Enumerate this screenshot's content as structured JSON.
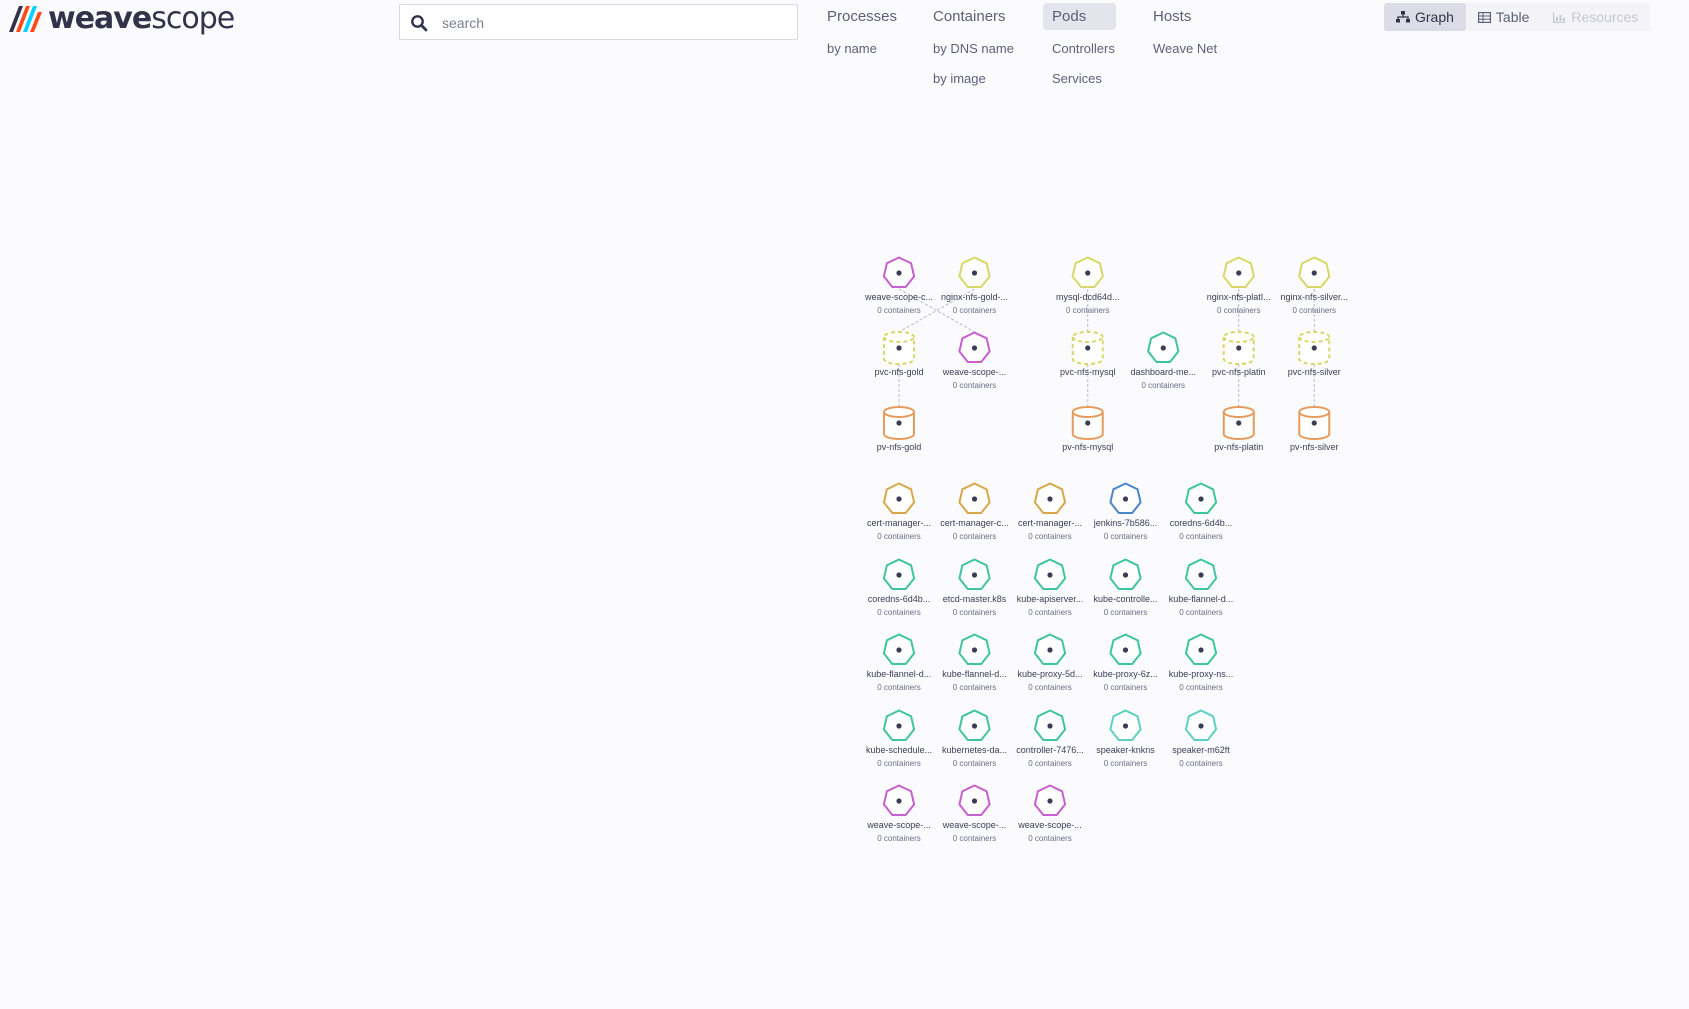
{
  "app": {
    "logo_weave": "weave",
    "logo_scope": "scope",
    "brand_colors": [
      "#ff4b19",
      "#00d2ff",
      "#32324b"
    ]
  },
  "search": {
    "placeholder": "search",
    "value": "",
    "icon": "search-icon"
  },
  "topologies": [
    {
      "label": "Processes",
      "active": false,
      "subs": [
        "by name"
      ]
    },
    {
      "label": "Containers",
      "active": false,
      "subs": [
        "by DNS name",
        "by image"
      ]
    },
    {
      "label": "Pods",
      "active": true,
      "subs": [
        "Controllers",
        "Services"
      ]
    },
    {
      "label": "Hosts",
      "active": false,
      "subs": [
        "Weave Net"
      ]
    }
  ],
  "view_modes": [
    {
      "label": "Graph",
      "icon": "graph-icon",
      "active": true,
      "disabled": false
    },
    {
      "label": "Table",
      "icon": "table-icon",
      "active": false,
      "disabled": false
    },
    {
      "label": "Resources",
      "icon": "resources-icon",
      "active": false,
      "disabled": true
    }
  ],
  "node_sublabel": "0 containers",
  "colors": {
    "magenta": "#c75fce",
    "yellow": "#d7d76a",
    "orange": "#e69b5e",
    "gold": "#d8a74a",
    "teal": "#3fc59b",
    "blue": "#4c86c6",
    "cyan": "#5dd0c2"
  },
  "nodes": [
    {
      "id": "n1",
      "label": "weave-scope-c...",
      "sub": true,
      "shape": "heptagon",
      "color": "magenta",
      "col": 0,
      "row": 0
    },
    {
      "id": "n2",
      "label": "nginx-nfs-gold-...",
      "sub": true,
      "shape": "heptagon",
      "color": "yellow",
      "col": 1,
      "row": 0
    },
    {
      "id": "n3",
      "label": "mysql-dcd64d...",
      "sub": true,
      "shape": "heptagon",
      "color": "yellow",
      "col": 2.5,
      "row": 0
    },
    {
      "id": "n4",
      "label": "nginx-nfs-platI...",
      "sub": true,
      "shape": "heptagon",
      "color": "yellow",
      "col": 4.5,
      "row": 0
    },
    {
      "id": "n5",
      "label": "nginx-nfs-silver...",
      "sub": true,
      "shape": "heptagon",
      "color": "yellow",
      "col": 5.5,
      "row": 0
    },
    {
      "id": "n6",
      "label": "pvc-nfs-gold",
      "sub": false,
      "shape": "cylinder-dashed",
      "color": "yellow",
      "col": 0,
      "row": 1
    },
    {
      "id": "n7",
      "label": "weave-scope-...",
      "sub": true,
      "shape": "heptagon",
      "color": "magenta",
      "col": 1,
      "row": 1
    },
    {
      "id": "n8",
      "label": "pvc-nfs-mysql",
      "sub": false,
      "shape": "cylinder-dashed",
      "color": "yellow",
      "col": 2.5,
      "row": 1
    },
    {
      "id": "n9",
      "label": "dashboard-me...",
      "sub": true,
      "shape": "heptagon",
      "color": "teal",
      "col": 3.5,
      "row": 1
    },
    {
      "id": "n10",
      "label": "pvc-nfs-platin",
      "sub": false,
      "shape": "cylinder-dashed",
      "color": "yellow",
      "col": 4.5,
      "row": 1
    },
    {
      "id": "n11",
      "label": "pvc-nfs-silver",
      "sub": false,
      "shape": "cylinder-dashed",
      "color": "yellow",
      "col": 5.5,
      "row": 1
    },
    {
      "id": "n12",
      "label": "pv-nfs-gold",
      "sub": false,
      "shape": "cylinder",
      "color": "orange",
      "col": 0,
      "row": 2
    },
    {
      "id": "n13",
      "label": "pv-nfs-mysql",
      "sub": false,
      "shape": "cylinder",
      "color": "orange",
      "col": 2.5,
      "row": 2
    },
    {
      "id": "n14",
      "label": "pv-nfs-platin",
      "sub": false,
      "shape": "cylinder",
      "color": "orange",
      "col": 4.5,
      "row": 2
    },
    {
      "id": "n15",
      "label": "pv-nfs-silver",
      "sub": false,
      "shape": "cylinder",
      "color": "orange",
      "col": 5.5,
      "row": 2
    },
    {
      "id": "g1",
      "label": "cert-manager-...",
      "sub": true,
      "shape": "heptagon",
      "color": "gold",
      "col": 0,
      "row": 3
    },
    {
      "id": "g2",
      "label": "cert-manager-c...",
      "sub": true,
      "shape": "heptagon",
      "color": "gold",
      "col": 1,
      "row": 3
    },
    {
      "id": "g3",
      "label": "cert-manager-...",
      "sub": true,
      "shape": "heptagon",
      "color": "gold",
      "col": 2,
      "row": 3
    },
    {
      "id": "g4",
      "label": "jenkins-7b586...",
      "sub": true,
      "shape": "heptagon",
      "color": "blue",
      "col": 3,
      "row": 3
    },
    {
      "id": "g5",
      "label": "coredns-6d4b...",
      "sub": true,
      "shape": "heptagon",
      "color": "teal",
      "col": 4,
      "row": 3
    },
    {
      "id": "g6",
      "label": "coredns-6d4b...",
      "sub": true,
      "shape": "heptagon",
      "color": "teal",
      "col": 0,
      "row": 4
    },
    {
      "id": "g7",
      "label": "etcd-master.k8s",
      "sub": true,
      "shape": "heptagon",
      "color": "teal",
      "col": 1,
      "row": 4
    },
    {
      "id": "g8",
      "label": "kube-apiserver...",
      "sub": true,
      "shape": "heptagon",
      "color": "teal",
      "col": 2,
      "row": 4
    },
    {
      "id": "g9",
      "label": "kube-controlle...",
      "sub": true,
      "shape": "heptagon",
      "color": "teal",
      "col": 3,
      "row": 4
    },
    {
      "id": "g10",
      "label": "kube-flannel-d...",
      "sub": true,
      "shape": "heptagon",
      "color": "teal",
      "col": 4,
      "row": 4
    },
    {
      "id": "g11",
      "label": "kube-flannel-d...",
      "sub": true,
      "shape": "heptagon",
      "color": "teal",
      "col": 0,
      "row": 5
    },
    {
      "id": "g12",
      "label": "kube-flannel-d...",
      "sub": true,
      "shape": "heptagon",
      "color": "teal",
      "col": 1,
      "row": 5
    },
    {
      "id": "g13",
      "label": "kube-proxy-5d...",
      "sub": true,
      "shape": "heptagon",
      "color": "teal",
      "col": 2,
      "row": 5
    },
    {
      "id": "g14",
      "label": "kube-proxy-6z...",
      "sub": true,
      "shape": "heptagon",
      "color": "teal",
      "col": 3,
      "row": 5
    },
    {
      "id": "g15",
      "label": "kube-proxy-ns...",
      "sub": true,
      "shape": "heptagon",
      "color": "teal",
      "col": 4,
      "row": 5
    },
    {
      "id": "g16",
      "label": "kube-schedule...",
      "sub": true,
      "shape": "heptagon",
      "color": "teal",
      "col": 0,
      "row": 6
    },
    {
      "id": "g17",
      "label": "kubernetes-da...",
      "sub": true,
      "shape": "heptagon",
      "color": "teal",
      "col": 1,
      "row": 6
    },
    {
      "id": "g18",
      "label": "controller-7476...",
      "sub": true,
      "shape": "heptagon",
      "color": "teal",
      "col": 2,
      "row": 6
    },
    {
      "id": "g19",
      "label": "speaker-knkns",
      "sub": true,
      "shape": "heptagon",
      "color": "cyan",
      "col": 3,
      "row": 6
    },
    {
      "id": "g20",
      "label": "speaker-m62ft",
      "sub": true,
      "shape": "heptagon",
      "color": "cyan",
      "col": 4,
      "row": 6
    },
    {
      "id": "g21",
      "label": "weave-scope-...",
      "sub": true,
      "shape": "heptagon",
      "color": "magenta",
      "col": 0,
      "row": 7
    },
    {
      "id": "g22",
      "label": "weave-scope-...",
      "sub": true,
      "shape": "heptagon",
      "color": "magenta",
      "col": 1,
      "row": 7
    },
    {
      "id": "g23",
      "label": "weave-scope-...",
      "sub": true,
      "shape": "heptagon",
      "color": "magenta",
      "col": 2,
      "row": 7
    }
  ],
  "edges": [
    [
      "n1",
      "n7"
    ],
    [
      "n2",
      "n6"
    ],
    [
      "n6",
      "n12"
    ],
    [
      "n3",
      "n8"
    ],
    [
      "n8",
      "n13"
    ],
    [
      "n4",
      "n10"
    ],
    [
      "n10",
      "n14"
    ],
    [
      "n5",
      "n11"
    ],
    [
      "n11",
      "n15"
    ]
  ]
}
